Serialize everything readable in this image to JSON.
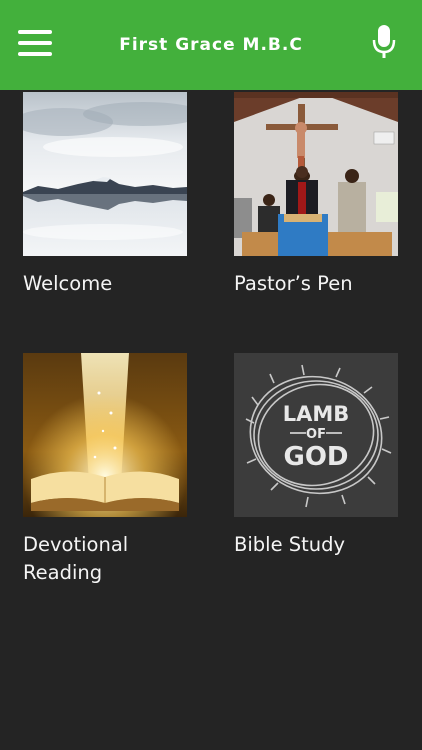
{
  "app_bar": {
    "title": "First Grace M.B.C",
    "color": "#43b03c",
    "menu_icon": "hamburger-menu-icon",
    "mic_icon": "microphone-icon"
  },
  "tiles": [
    {
      "label": "Welcome",
      "image": "mountain-lake-reflection"
    },
    {
      "label": "Pastor’s Pen",
      "image": "pastor-at-pulpit-photo"
    },
    {
      "label": "Devotional Reading",
      "image": "glowing-open-bible"
    },
    {
      "label": "Bible Study",
      "image": "lamb-of-god-crown-of-thorns"
    }
  ],
  "lamb_art": {
    "line1": "LAMB",
    "line2": "OF",
    "line3": "GOD"
  }
}
